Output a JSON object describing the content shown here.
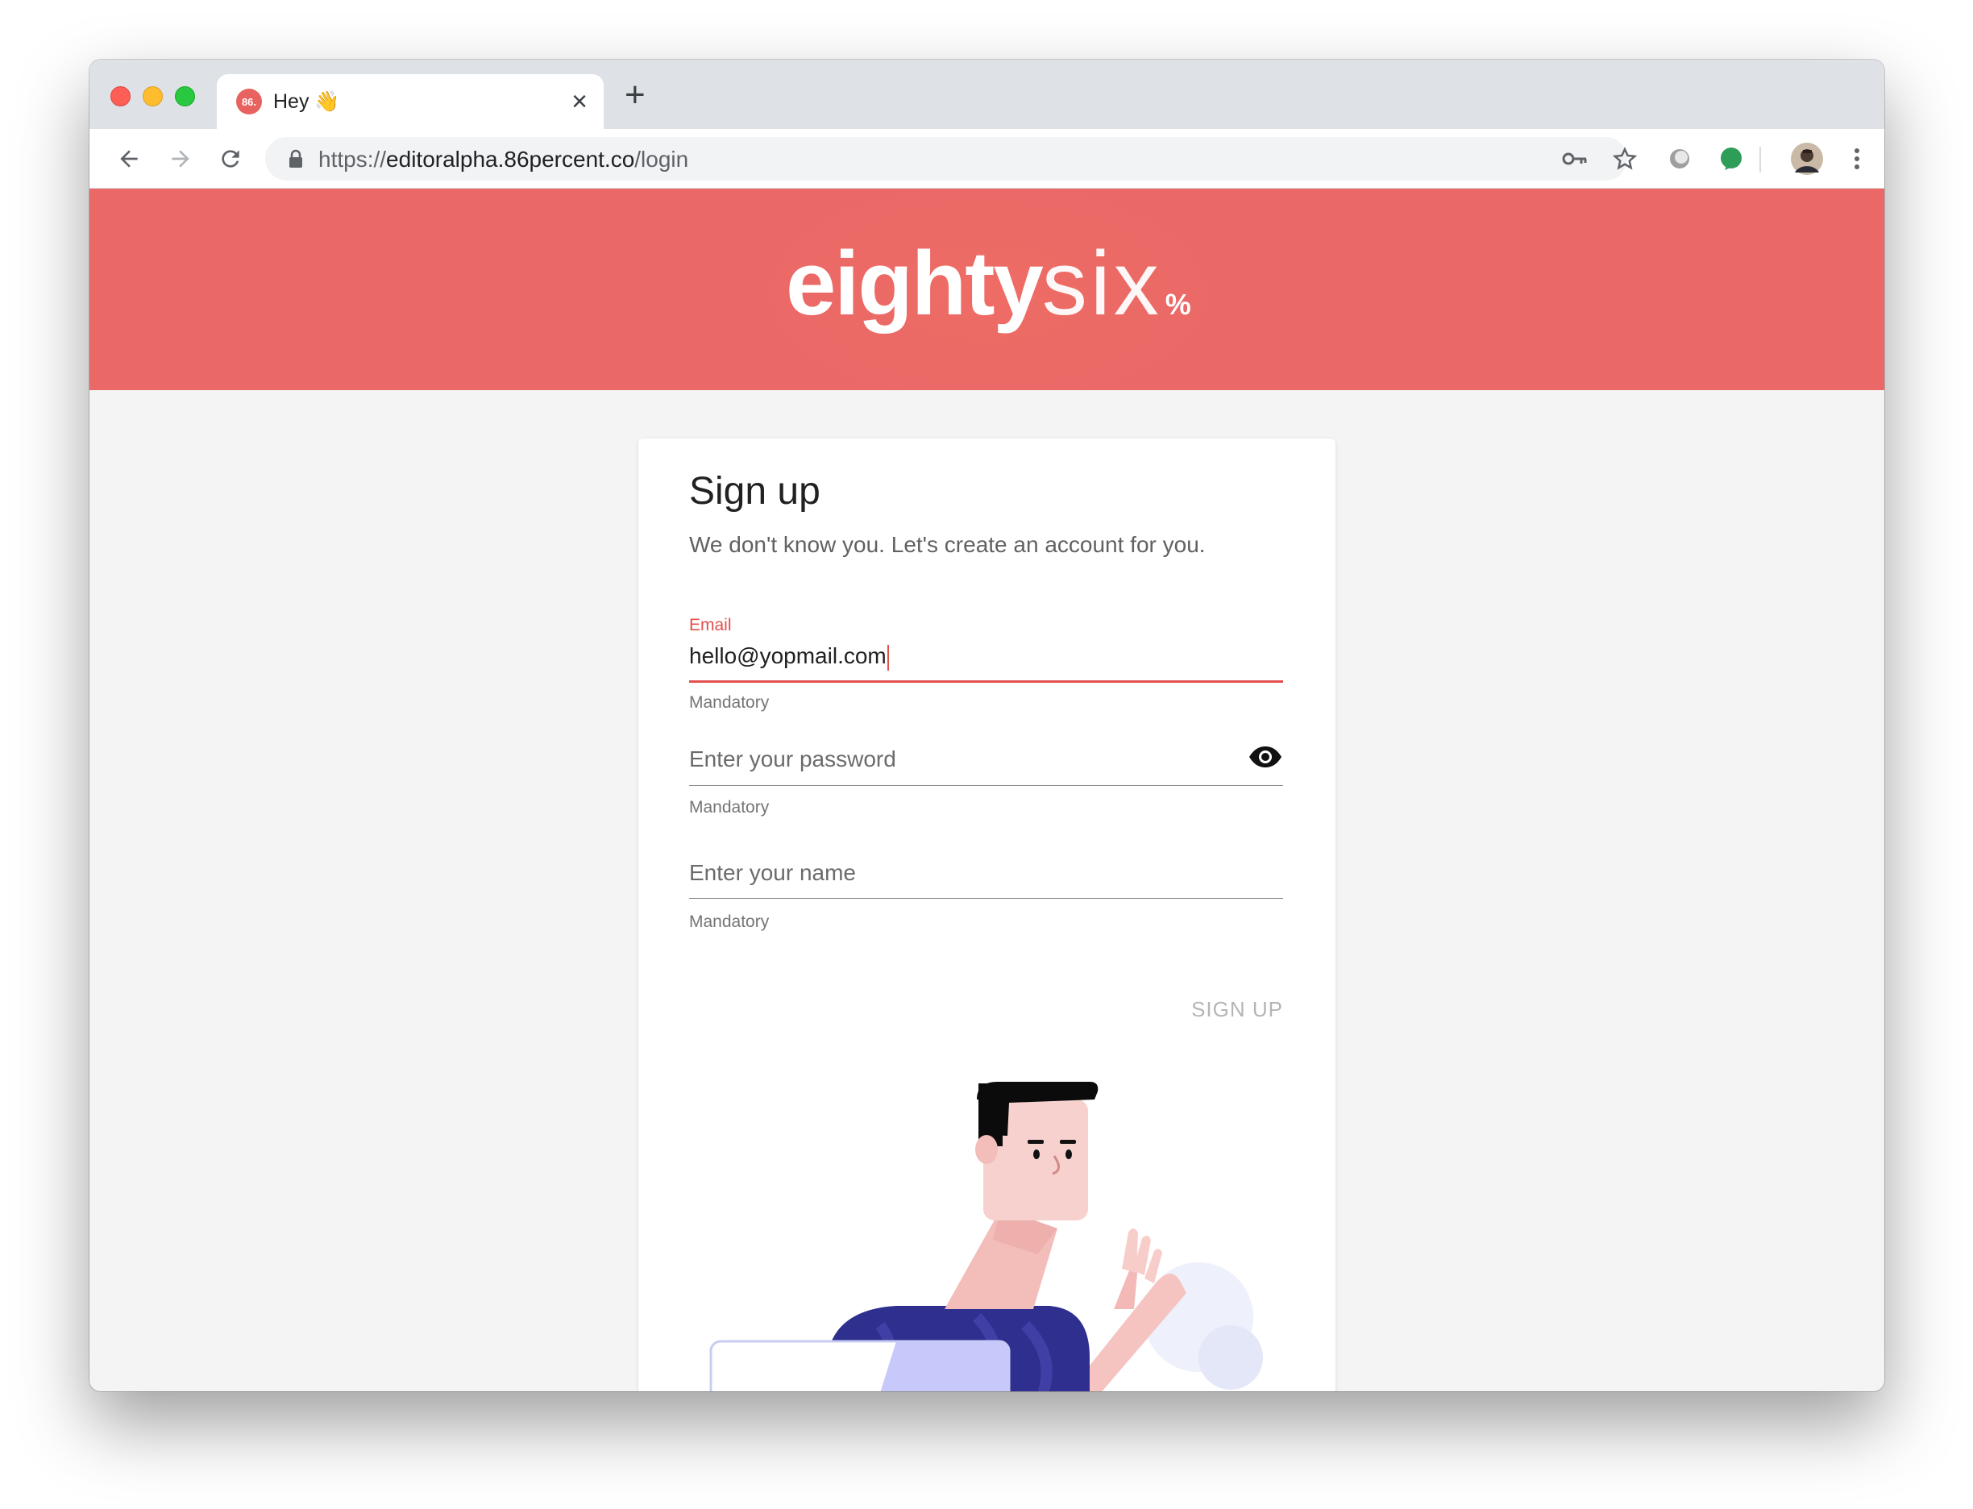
{
  "browser": {
    "tab": {
      "favicon_text": "86.",
      "title": "Hey 👋"
    },
    "url": {
      "scheme": "https://",
      "host": "editoralpha.86percent.co",
      "path": "/login"
    }
  },
  "banner": {
    "logo_bold": "eighty",
    "logo_light": "six",
    "logo_pct": "%"
  },
  "card": {
    "title": "Sign up",
    "subtitle": "We don't know you. Let's create an account for you.",
    "email": {
      "label": "Email",
      "value": "hello@yopmail.com",
      "helper": "Mandatory"
    },
    "password": {
      "placeholder": "Enter your password",
      "helper": "Mandatory"
    },
    "name": {
      "placeholder": "Enter your name",
      "helper": "Mandatory"
    },
    "submit_label": "SIGN UP"
  },
  "colors": {
    "brand": "#ea6866",
    "accent": "#e2504d",
    "shirt": "#2f2f8f"
  }
}
